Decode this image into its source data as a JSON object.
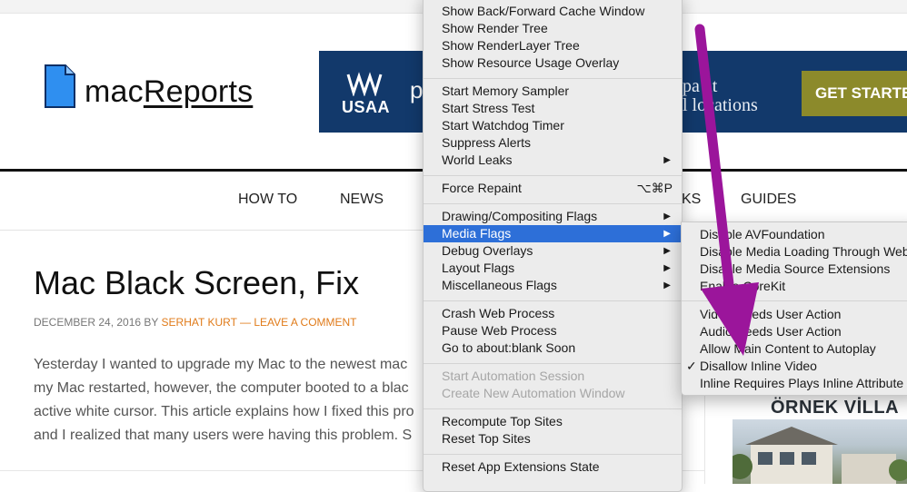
{
  "site": {
    "logo_prefix": "mac",
    "logo_suffix": "Reports"
  },
  "ad_banner": {
    "brand": "USAA",
    "letter_p": "p",
    "line1": "pa  at",
    "line2": "l locations",
    "cta": "GET STARTE"
  },
  "nav": {
    "items": [
      "HOW TO",
      "NEWS",
      "KS",
      "GUIDES"
    ]
  },
  "article": {
    "title": "Mac Black Screen, Fix",
    "date": "DECEMBER 24, 2016",
    "by": "BY",
    "author": "SERHAT KURT",
    "dash": "—",
    "comment_link": "LEAVE A COMMENT",
    "lines": [
      "Yesterday I wanted to upgrade my Mac to the newest mac",
      "my Mac restarted, however, the computer booted to a blac",
      "active white cursor. This article explains how I fixed this pro",
      "and I realized that many users were having this problem. S"
    ]
  },
  "side_ad": {
    "title": "ÖRNEK VİLLA"
  },
  "develop_menu": {
    "items": [
      {
        "label": "Show Back/Forward Cache Window"
      },
      {
        "label": "Show Render Tree"
      },
      {
        "label": "Show RenderLayer Tree"
      },
      {
        "label": "Show Resource Usage Overlay"
      },
      {
        "label": "Start Memory Sampler"
      },
      {
        "label": "Start Stress Test"
      },
      {
        "label": "Start Watchdog Timer"
      },
      {
        "label": "Suppress Alerts"
      },
      {
        "label": "World Leaks",
        "submenu": "▶"
      },
      {
        "label": "Force Repaint",
        "shortcut": "⌥⌘P"
      },
      {
        "label": "Drawing/Compositing Flags",
        "submenu": "▶"
      },
      {
        "label": "Media Flags",
        "submenu": "▶",
        "highlighted": true
      },
      {
        "label": "Debug Overlays",
        "submenu": "▶"
      },
      {
        "label": "Layout Flags",
        "submenu": "▶"
      },
      {
        "label": "Miscellaneous Flags",
        "submenu": "▶"
      },
      {
        "label": "Crash Web Process"
      },
      {
        "label": "Pause Web Process"
      },
      {
        "label": "Go to about:blank Soon"
      },
      {
        "label": "Start Automation Session",
        "disabled": true
      },
      {
        "label": "Create New Automation Window",
        "disabled": true
      },
      {
        "label": "Recompute Top Sites"
      },
      {
        "label": "Reset Top Sites"
      },
      {
        "label": "Reset App Extensions State"
      }
    ]
  },
  "media_flags_menu": {
    "items": [
      {
        "label": "Disable AVFoundation"
      },
      {
        "label": "Disable Media Loading Through WebKit"
      },
      {
        "label": "Disable Media Source Extensions"
      },
      {
        "label": "Enable CoreKit"
      },
      {
        "label": "Video Needs User Action"
      },
      {
        "label": "Audio Needs User Action"
      },
      {
        "label": "Allow Main Content to Autoplay"
      },
      {
        "label": "Disallow Inline Video",
        "checked": true,
        "check": "✓"
      },
      {
        "label": "Inline Requires Plays Inline Attribute"
      }
    ]
  },
  "colors": {
    "highlight": "#2d6fd8",
    "arrow": "#9b159b",
    "banner": "#12396b",
    "accent_orange": "#e07b1a"
  }
}
